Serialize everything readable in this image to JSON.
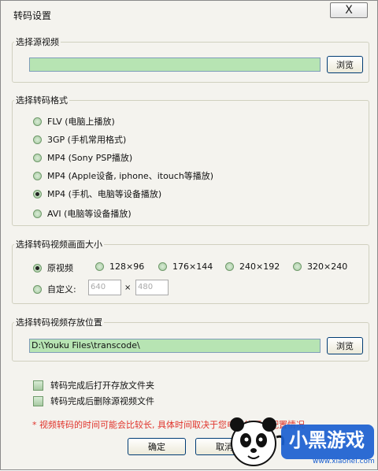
{
  "window": {
    "title": "转码设置",
    "close_glyph": "X"
  },
  "source": {
    "legend": "选择源视频",
    "path_value": "",
    "browse_label": "浏览"
  },
  "format": {
    "legend": "选择转码格式",
    "options": [
      {
        "label": "FLV (电脑上播放)",
        "checked": false
      },
      {
        "label": "3GP (手机常用格式)",
        "checked": false
      },
      {
        "label": "MP4 (Sony PSP播放)",
        "checked": false
      },
      {
        "label": "MP4 (Apple设备, iphone、itouch等播放)",
        "checked": false
      },
      {
        "label": "MP4 (手机、电脑等设备播放)",
        "checked": true
      },
      {
        "label": "AVI (电脑等设备播放)",
        "checked": false
      }
    ]
  },
  "size": {
    "legend": "选择转码视频画面大小",
    "options": [
      {
        "label": "原视频",
        "checked": true
      },
      {
        "label": "128×96",
        "checked": false
      },
      {
        "label": "176×144",
        "checked": false
      },
      {
        "label": "240×192",
        "checked": false
      },
      {
        "label": "320×240",
        "checked": false
      }
    ],
    "custom_label": "自定义:",
    "custom_width": "640",
    "custom_sep": "×",
    "custom_height": "480"
  },
  "output": {
    "legend": "选择转码视频存放位置",
    "path_value": "D:\\Youku Files\\transcode\\",
    "browse_label": "浏览"
  },
  "checkboxes": [
    {
      "label": "转码完成后打开存放文件夹",
      "checked": false
    },
    {
      "label": "转码完成后删除源视频文件",
      "checked": false
    }
  ],
  "note": "* 视频转码的时间可能会比较长, 具体时间取决于您电脑的硬件配置情况",
  "buttons": {
    "ok": "确定",
    "cancel": "取消"
  },
  "watermark": {
    "brand": "小黑游戏",
    "url": "www.xiaohei.com"
  },
  "colors": {
    "input_green": "#b7e4b3",
    "note_red": "#e0332b",
    "brand_blue": "#1a5fd0"
  }
}
